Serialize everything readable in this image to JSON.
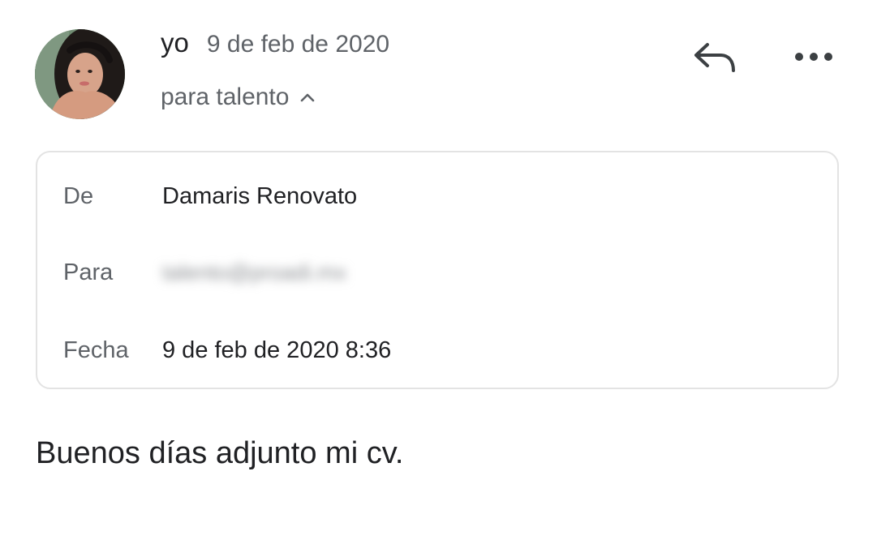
{
  "message": {
    "sender": "yo",
    "date": "9 de feb de 2020",
    "recipient_summary": "para talento",
    "body": "Buenos días adjunto mi cv."
  },
  "details": {
    "from_label": "De",
    "from_value": "Damaris Renovato",
    "to_label": "Para",
    "to_value_redacted": "talento@proadi.mx",
    "date_label": "Fecha",
    "date_value": "9 de feb de 2020 8:36"
  },
  "icons": {
    "avatar": "profile-photo",
    "caret": "chevron-up-icon",
    "reply": "reply-icon",
    "more": "more-horizontal-icon"
  },
  "colors": {
    "text_primary": "#202124",
    "text_secondary": "#5f6368",
    "card_border": "#e3e3e3",
    "background": "#ffffff"
  }
}
